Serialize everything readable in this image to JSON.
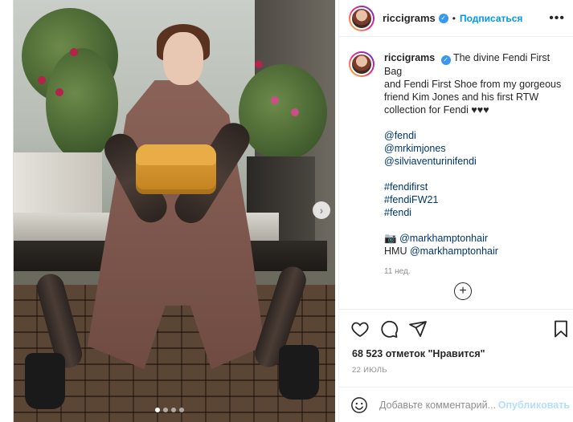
{
  "post": {
    "header": {
      "username": "riccigrams",
      "separator": "•",
      "follow_label": "Подписаться",
      "more_icon": "more-options-icon"
    },
    "caption": {
      "username": "riccigrams",
      "text_lines": [
        "The divine Fendi First Bag",
        "and Fendi First Shoe from my gorgeous",
        "friend Kim Jones and his first RTW",
        "collection for Fendi ♥♥♥"
      ],
      "mentions": [
        "@fendi",
        "@mrkimjones",
        "@silviaventurinifendi"
      ],
      "hashtags": [
        "#fendifirst",
        "#fendiFW21",
        "#fendi"
      ],
      "credit_photo": "@markhamptonhair",
      "credit_hmu_prefix": "HMU",
      "credit_hmu": "@markhamptonhair",
      "time_ago": "11 нед."
    },
    "likes_text": "68 523 отметок \"Нравится\"",
    "date_text": "22 ИЮЛЬ",
    "comment": {
      "placeholder": "Добавьте комментарий...",
      "publish_label": "Опубликовать"
    },
    "carousel": {
      "slide_count": 4,
      "active_index": 0
    },
    "colors": {
      "link": "#00376b",
      "follow": "#0095f6",
      "publish_disabled": "#b2dffc",
      "verified": "#3897f0"
    }
  }
}
